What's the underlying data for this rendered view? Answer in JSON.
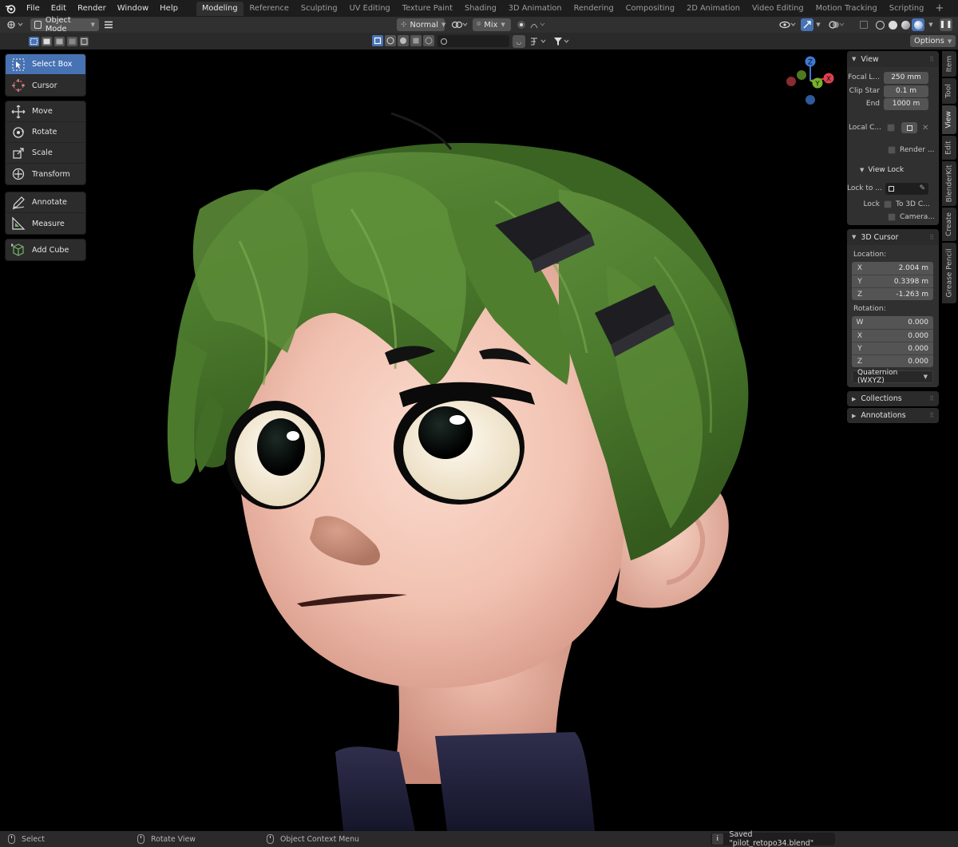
{
  "menu": {
    "items": [
      "File",
      "Edit",
      "Render",
      "Window",
      "Help"
    ]
  },
  "workspaces": {
    "tabs": [
      "Modeling",
      "Reference",
      "Sculpting",
      "UV Editing",
      "Texture Paint",
      "Shading",
      "3D Animation",
      "Rendering",
      "Compositing",
      "2D Animation",
      "Video Editing",
      "Motion Tracking",
      "Scripting"
    ],
    "active": "Modeling",
    "add_symbol": "+"
  },
  "header": {
    "mode": "Object Mode",
    "orientation": "Normal",
    "pivot": "Mix",
    "options": "Options"
  },
  "toolbar": {
    "select_box": "Select Box",
    "cursor": "Cursor",
    "move": "Move",
    "rotate": "Rotate",
    "scale": "Scale",
    "transform": "Transform",
    "annotate": "Annotate",
    "measure": "Measure",
    "add_cube": "Add Cube"
  },
  "gizmo": {
    "z": "Z",
    "y": "Y",
    "x": "X"
  },
  "npanel": {
    "view": {
      "title": "View",
      "focal_label": "Focal L...",
      "focal_value": "250 mm",
      "clip_start_label": "Clip Star",
      "clip_start_value": "0.1 m",
      "end_label": "End",
      "end_value": "1000 m",
      "local_camera_label": "Local C...",
      "render_label": "Render ...",
      "view_lock_title": "View Lock",
      "lock_to_label": "Lock to ...",
      "lock_label": "Lock",
      "to_3d_cursor": "To 3D C...",
      "camera": "Camera..."
    },
    "cursor": {
      "title": "3D Cursor",
      "location_label": "Location:",
      "x_label": "X",
      "x_value": "2.004 m",
      "y_label": "Y",
      "y_value": "0.3398 m",
      "z_label": "Z",
      "z_value": "-1.263 m",
      "rotation_label": "Rotation:",
      "rw_label": "W",
      "rw_value": "0.000",
      "rx_label": "X",
      "rx_value": "0.000",
      "ry_label": "Y",
      "ry_value": "0.000",
      "rz_label": "Z",
      "rz_value": "0.000",
      "rotation_mode": "Quaternion (WXYZ)"
    },
    "collections": "Collections",
    "annotations": "Annotations"
  },
  "sidetabs": [
    "Item",
    "Tool",
    "View",
    "Edit",
    "BlenderKit",
    "Create",
    "Grease Pencil"
  ],
  "status": {
    "select": "Select",
    "rotate_view": "Rotate View",
    "context_menu": "Object Context Menu",
    "saved": "Saved \"pilot_retopo34.blend\""
  },
  "colors": {
    "accent": "#4772b3",
    "hair": "#4d7a2e",
    "skin": "#f3c4b3",
    "background": "#000000"
  }
}
